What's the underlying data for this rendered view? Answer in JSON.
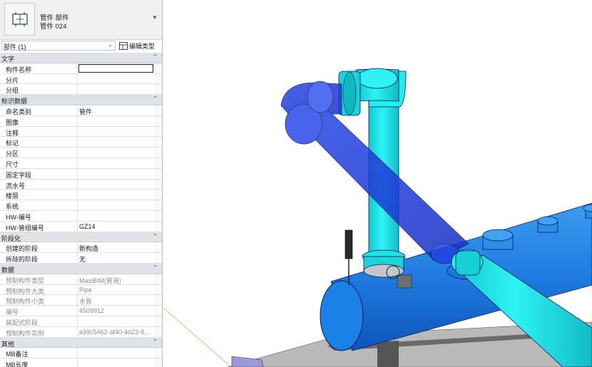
{
  "properties_panel": {
    "type_selector": {
      "family": "管件 部件",
      "type": "管件 024"
    },
    "instance_filter": "部件 (1)",
    "edit_type_label": "编辑类型",
    "groups": [
      {
        "name": "文字",
        "rows": [
          {
            "name": "构件名称",
            "value": "",
            "editing": true
          },
          {
            "name": "分片",
            "value": ""
          },
          {
            "name": "分组",
            "value": ""
          }
        ]
      },
      {
        "name": "标识数据",
        "rows": [
          {
            "name": "命名类别",
            "value": "管件"
          },
          {
            "name": "图像",
            "value": ""
          },
          {
            "name": "注释",
            "value": ""
          },
          {
            "name": "标记",
            "value": ""
          },
          {
            "name": "分区",
            "value": ""
          },
          {
            "name": "尺寸",
            "value": ""
          },
          {
            "name": "固定字段",
            "value": ""
          },
          {
            "name": "流水号",
            "value": ""
          },
          {
            "name": "楼层",
            "value": ""
          },
          {
            "name": "系统",
            "value": ""
          },
          {
            "name": "HW-编号",
            "value": ""
          },
          {
            "name": "HW-管组编号",
            "value": "GZ14"
          }
        ]
      },
      {
        "name": "阶段化",
        "rows": [
          {
            "name": "创建的阶段",
            "value": "新构造"
          },
          {
            "name": "拆除的阶段",
            "value": "无"
          }
        ]
      },
      {
        "name": "数据",
        "rows": [
          {
            "name": "预制构件类型",
            "value": "MaxiBIM(管道)",
            "readonly": true
          },
          {
            "name": "预制构件大类",
            "value": "Pipe",
            "readonly": true
          },
          {
            "name": "预制构件小类",
            "value": "水管",
            "readonly": true
          },
          {
            "name": "编号",
            "value": "4509912",
            "readonly": true
          },
          {
            "name": "装配式阶段",
            "value": "",
            "readonly": true
          },
          {
            "name": "预制构件实例",
            "value": "a99c5462-af40-4d23-8...",
            "readonly": true
          }
        ]
      },
      {
        "name": "其他",
        "rows": [
          {
            "name": "MB备注",
            "value": ""
          },
          {
            "name": "MB长度",
            "value": ""
          }
        ]
      }
    ]
  },
  "viewport": {
    "pipe_color": "#1fe6e6",
    "header_color": "#2a86e8",
    "selected_color": "#1a3be0",
    "edge_color": "#0a1a55"
  }
}
